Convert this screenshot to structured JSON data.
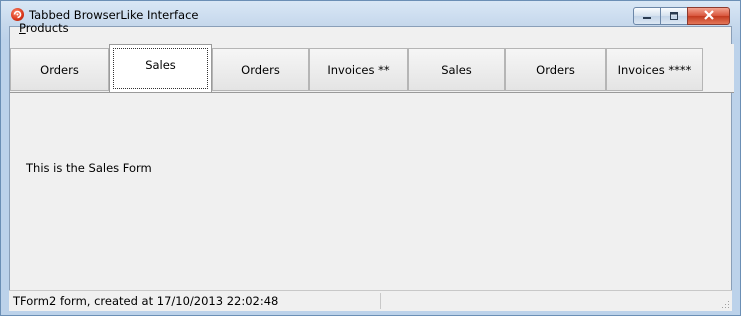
{
  "window": {
    "title": "Tabbed BrowserLike Interface"
  },
  "menu": {
    "items": [
      {
        "prefix": "",
        "accel": "P",
        "rest": "roducts"
      }
    ]
  },
  "tabs": [
    {
      "label": "Orders",
      "active": false
    },
    {
      "label": "Sales",
      "active": true
    },
    {
      "label": "Orders",
      "active": false
    },
    {
      "label": "Invoices **",
      "active": false
    },
    {
      "label": "Sales",
      "active": false
    },
    {
      "label": "Orders",
      "active": false
    },
    {
      "label": "Invoices ****",
      "active": false
    }
  ],
  "content": {
    "text": "This is the Sales Form"
  },
  "status": {
    "panel1": "TForm2 form, created at 17/10/2013 22:02:48",
    "panel2": ""
  },
  "icons": {
    "app": "app-icon",
    "minimize": "minimize-icon",
    "maximize": "maximize-icon",
    "close": "close-icon",
    "grip": "size-grip-icon"
  },
  "colors": {
    "title_gradient_top": "#d9e7f5",
    "title_gradient_bottom": "#bcd2ea",
    "client_bg": "#f0f0f0",
    "close_button": "#c33a1f"
  }
}
